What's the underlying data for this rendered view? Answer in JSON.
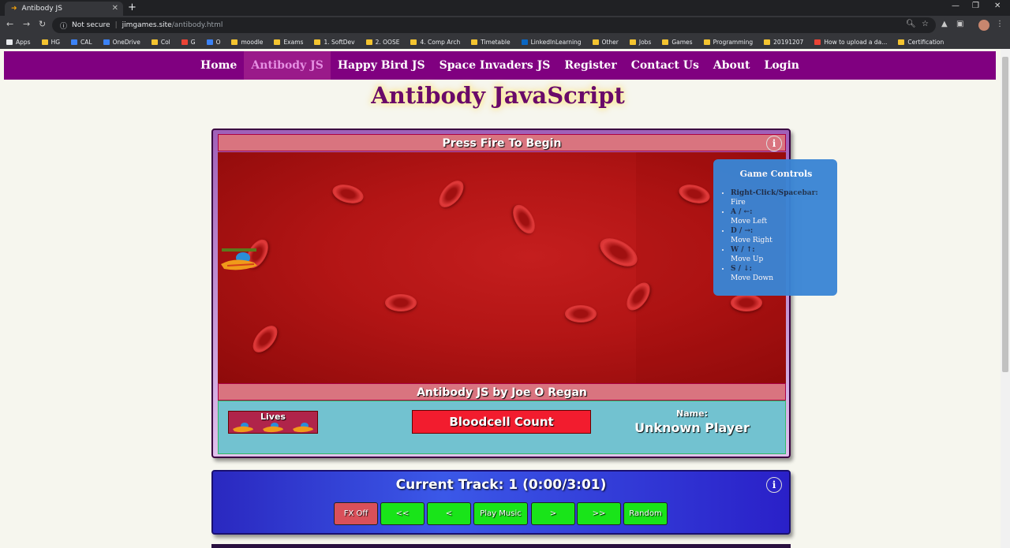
{
  "browser": {
    "tab_title": "Antibody JS",
    "new_tab": "+",
    "tab_close": "✕",
    "not_secure": "Not secure",
    "url_host": "jimgames.site",
    "url_path": "/antibody.html",
    "bookmarks": [
      "Apps",
      "HG",
      "CAL",
      "OneDrive",
      "Col",
      "G",
      "O",
      "moodle",
      "Exams",
      "1. SoftDev",
      "2. OOSE",
      "4. Comp Arch",
      "Timetable",
      "LinkedInLearning",
      "Other",
      "Jobs",
      "Games",
      "Programming",
      "20191207",
      "How to upload a da...",
      "Certification"
    ]
  },
  "nav": {
    "items": [
      "Home",
      "Antibody JS",
      "Happy Bird JS",
      "Space Invaders JS",
      "Register",
      "Contact Us",
      "About",
      "Login"
    ],
    "active": "Antibody JS"
  },
  "page_title": "Antibody JavaScript",
  "game": {
    "header": "Press Fire To Begin",
    "footer": "Antibody JS by Joe O Regan",
    "lives_label": "Lives",
    "lives_count": 3,
    "bloodcell_label": "Bloodcell Count",
    "name_label": "Name:",
    "name_value": "Unknown Player",
    "info_glyph": "i"
  },
  "controls": {
    "title": "Game Controls",
    "items": [
      {
        "key": "Right-Click/Spacebar:",
        "action": "Fire"
      },
      {
        "key": "A / ←:",
        "action": "Move Left"
      },
      {
        "key": "D / →:",
        "action": "Move Right"
      },
      {
        "key": "W / ↑:",
        "action": "Move Up"
      },
      {
        "key": "S / ↓:",
        "action": "Move Down"
      }
    ]
  },
  "music": {
    "track_text": "Current Track: 1 (0:00/3:01)",
    "buttons": [
      "FX Off",
      "<<",
      "<",
      "Play Music",
      ">",
      ">>",
      "Random"
    ]
  },
  "colors": {
    "nav_bg": "#800080",
    "title": "#6a0a6a",
    "blood": "#b31515",
    "status_bg": "#72c2d0",
    "music_bg": "#3b58e8",
    "button_green": "#19e419"
  }
}
